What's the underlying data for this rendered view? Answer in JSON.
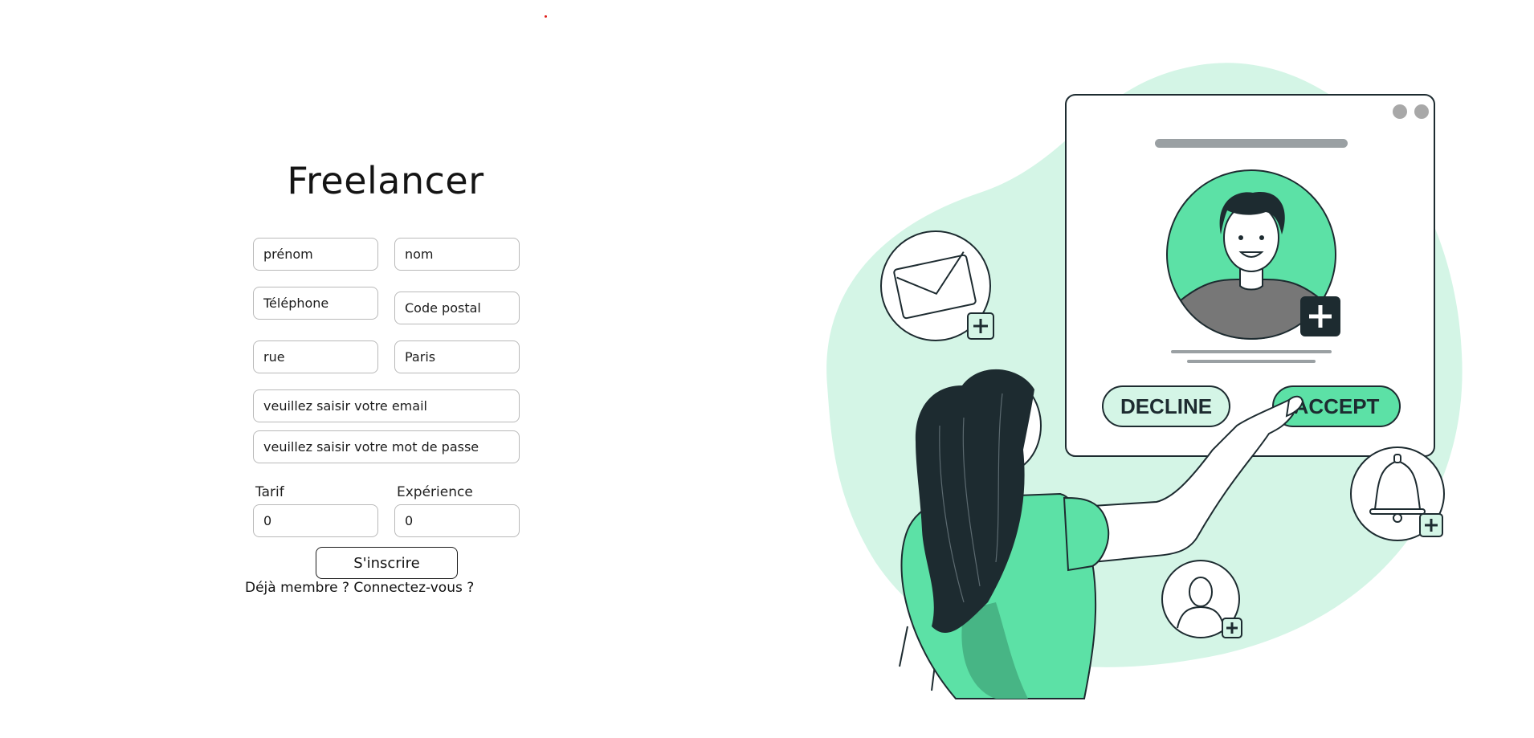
{
  "page": {
    "title": "Freelancer"
  },
  "form": {
    "firstname_placeholder": "prénom",
    "lastname_placeholder": "nom",
    "phone_placeholder": "Téléphone",
    "postal_placeholder": "Code postal",
    "street_placeholder": "rue",
    "city_value": "Paris",
    "email_placeholder": "veuillez saisir votre email",
    "password_placeholder": "veuillez saisir votre mot de passe",
    "rate_label": "Tarif",
    "rate_value": "0",
    "experience_label": "Expérience",
    "experience_value": "0",
    "submit_label": "S'inscrire",
    "member_text": "Déjà membre ?",
    "login_link": "Connectez-vous ?"
  },
  "illustration": {
    "decline_label": "DECLINE",
    "accept_label": "ACCEPT",
    "accent_color": "#5ce1a6",
    "light_color": "#d4f5e6",
    "dark_color": "#1d2b30"
  }
}
